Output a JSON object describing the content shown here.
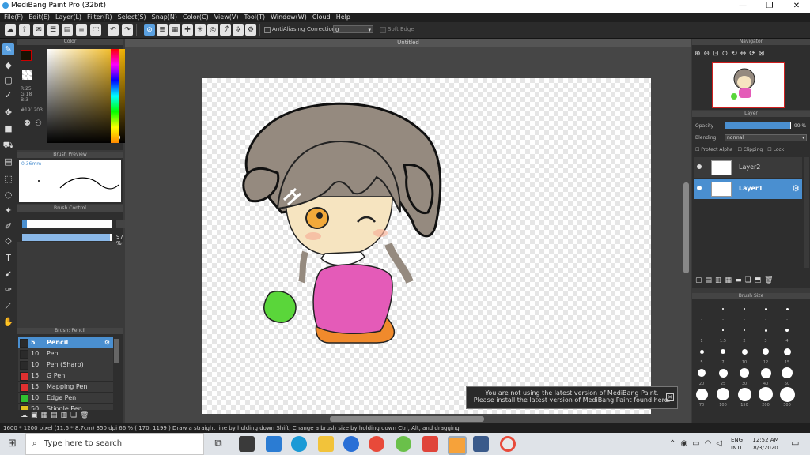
{
  "window": {
    "title": "MediBang Paint Pro (32bit)"
  },
  "menu": [
    "File(F)",
    "Edit(E)",
    "Layer(L)",
    "Filter(R)",
    "Select(S)",
    "Snap(N)",
    "Color(C)",
    "View(V)",
    "Tool(T)",
    "Window(W)",
    "Cloud",
    "Help"
  ],
  "toolbar": {
    "antialias_label": "AntiAliasing",
    "correction_label": "Correction",
    "correction_value": "0",
    "soft_edge_label": "Soft Edge"
  },
  "color_panel": {
    "title": "Color",
    "r": "R:25",
    "g": "G:18",
    "b": "B:3",
    "hex": "#191203",
    "primary_color": "#191203"
  },
  "brush_preview": {
    "title": "Brush Preview",
    "size": "0.36mm"
  },
  "brush_control": {
    "title": "Brush Control",
    "size_value": "5",
    "opacity_value": "97 %",
    "size_fraction": 0.05,
    "opacity_fraction": 0.97
  },
  "brush_panel": {
    "title": "Brush: Pencil",
    "items": [
      {
        "num": "5",
        "name": "Pencil",
        "color": "#2a2a2a",
        "selected": true
      },
      {
        "num": "10",
        "name": "Pen",
        "color": "#2a2a2a"
      },
      {
        "num": "10",
        "name": "Pen (Sharp)",
        "color": "#2a2a2a"
      },
      {
        "num": "15",
        "name": "G Pen",
        "color": "#e03030"
      },
      {
        "num": "15",
        "name": "Mapping Pen",
        "color": "#e03030"
      },
      {
        "num": "10",
        "name": "Edge Pen",
        "color": "#30c030"
      },
      {
        "num": "50",
        "name": "Stipple Pen",
        "color": "#e0c020"
      }
    ]
  },
  "canvas": {
    "tab": "Untitled"
  },
  "navigator": {
    "title": "Navigator"
  },
  "layer_panel": {
    "title": "Layer",
    "opacity_label": "Opacity",
    "opacity_value": "99 %",
    "opacity_fraction": 0.99,
    "blending_label": "Blending",
    "blending_value": "normal",
    "protect_alpha": "Protect Alpha",
    "clipping": "Clipping",
    "lock": "Lock",
    "layers": [
      {
        "name": "Layer2",
        "selected": false
      },
      {
        "name": "Layer1",
        "selected": true
      }
    ]
  },
  "brush_size": {
    "title": "Brush Size",
    "rows": [
      [
        "-",
        "-",
        "-",
        "-",
        "-"
      ],
      [
        "1",
        "1.5",
        "2",
        "3",
        "4"
      ],
      [
        "5",
        "7",
        "10",
        "12",
        "15"
      ],
      [
        "20",
        "25",
        "30",
        "40",
        "50"
      ],
      [
        "70",
        "100",
        "150",
        "200",
        "300"
      ]
    ]
  },
  "toast": {
    "line1": "You are not using the latest version of MediBang Paint.",
    "line2": "Please install the latest version of MediBang Paint found here."
  },
  "status": {
    "text": "1600 * 1200 pixel  (11.6 * 8.7cm)  350 dpi  66 %  ( 170, 1199 )  Draw a straight line by holding down Shift, Change a brush size by holding down Ctrl, Alt, and dragging"
  },
  "taskbar": {
    "search_placeholder": "Type here to search",
    "lang1": "ENG",
    "lang2": "INTL",
    "time": "12:52 AM",
    "date": "8/3/2020"
  }
}
